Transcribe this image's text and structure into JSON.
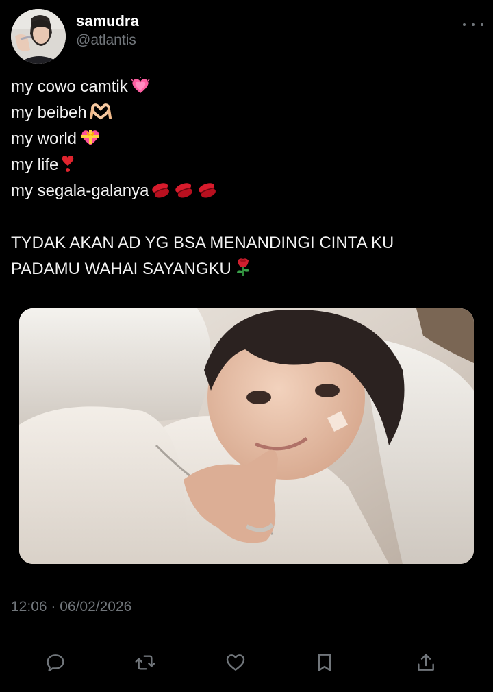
{
  "author": {
    "display_name": "samudra",
    "handle": "@atlantis"
  },
  "tweet": {
    "lines": [
      {
        "text": "my cowo camtik",
        "emoji": "growing-heart-icon"
      },
      {
        "text": "my beibeh",
        "emoji": "heart-hands-icon"
      },
      {
        "text": "my world",
        "emoji": "heart-with-ribbon-icon"
      },
      {
        "text": "my life",
        "emoji": "heart-exclamation-icon"
      },
      {
        "text": "my segala-galanya",
        "emoji": "kiss-mark-icon x3"
      },
      {
        "text": ""
      },
      {
        "text": "TYDAK AKAN AD YG BSA MENANDINGI CINTA KU"
      },
      {
        "text": "PADAMU WAHAI SAYANGKU",
        "emoji": "rose-icon"
      }
    ],
    "timestamp": "12:06 · 06/02/2026"
  },
  "media": {
    "icon": "photo-of-person-lying-on-pillow"
  },
  "actions": [
    {
      "name": "reply",
      "icon": "reply-icon"
    },
    {
      "name": "retweet",
      "icon": "retweet-icon"
    },
    {
      "name": "like",
      "icon": "heart-icon"
    },
    {
      "name": "bookmark",
      "icon": "bookmark-icon"
    },
    {
      "name": "share",
      "icon": "share-icon"
    }
  ],
  "colors": {
    "background": "#000000",
    "text": "#e7e9ea",
    "secondary": "#71767b"
  }
}
